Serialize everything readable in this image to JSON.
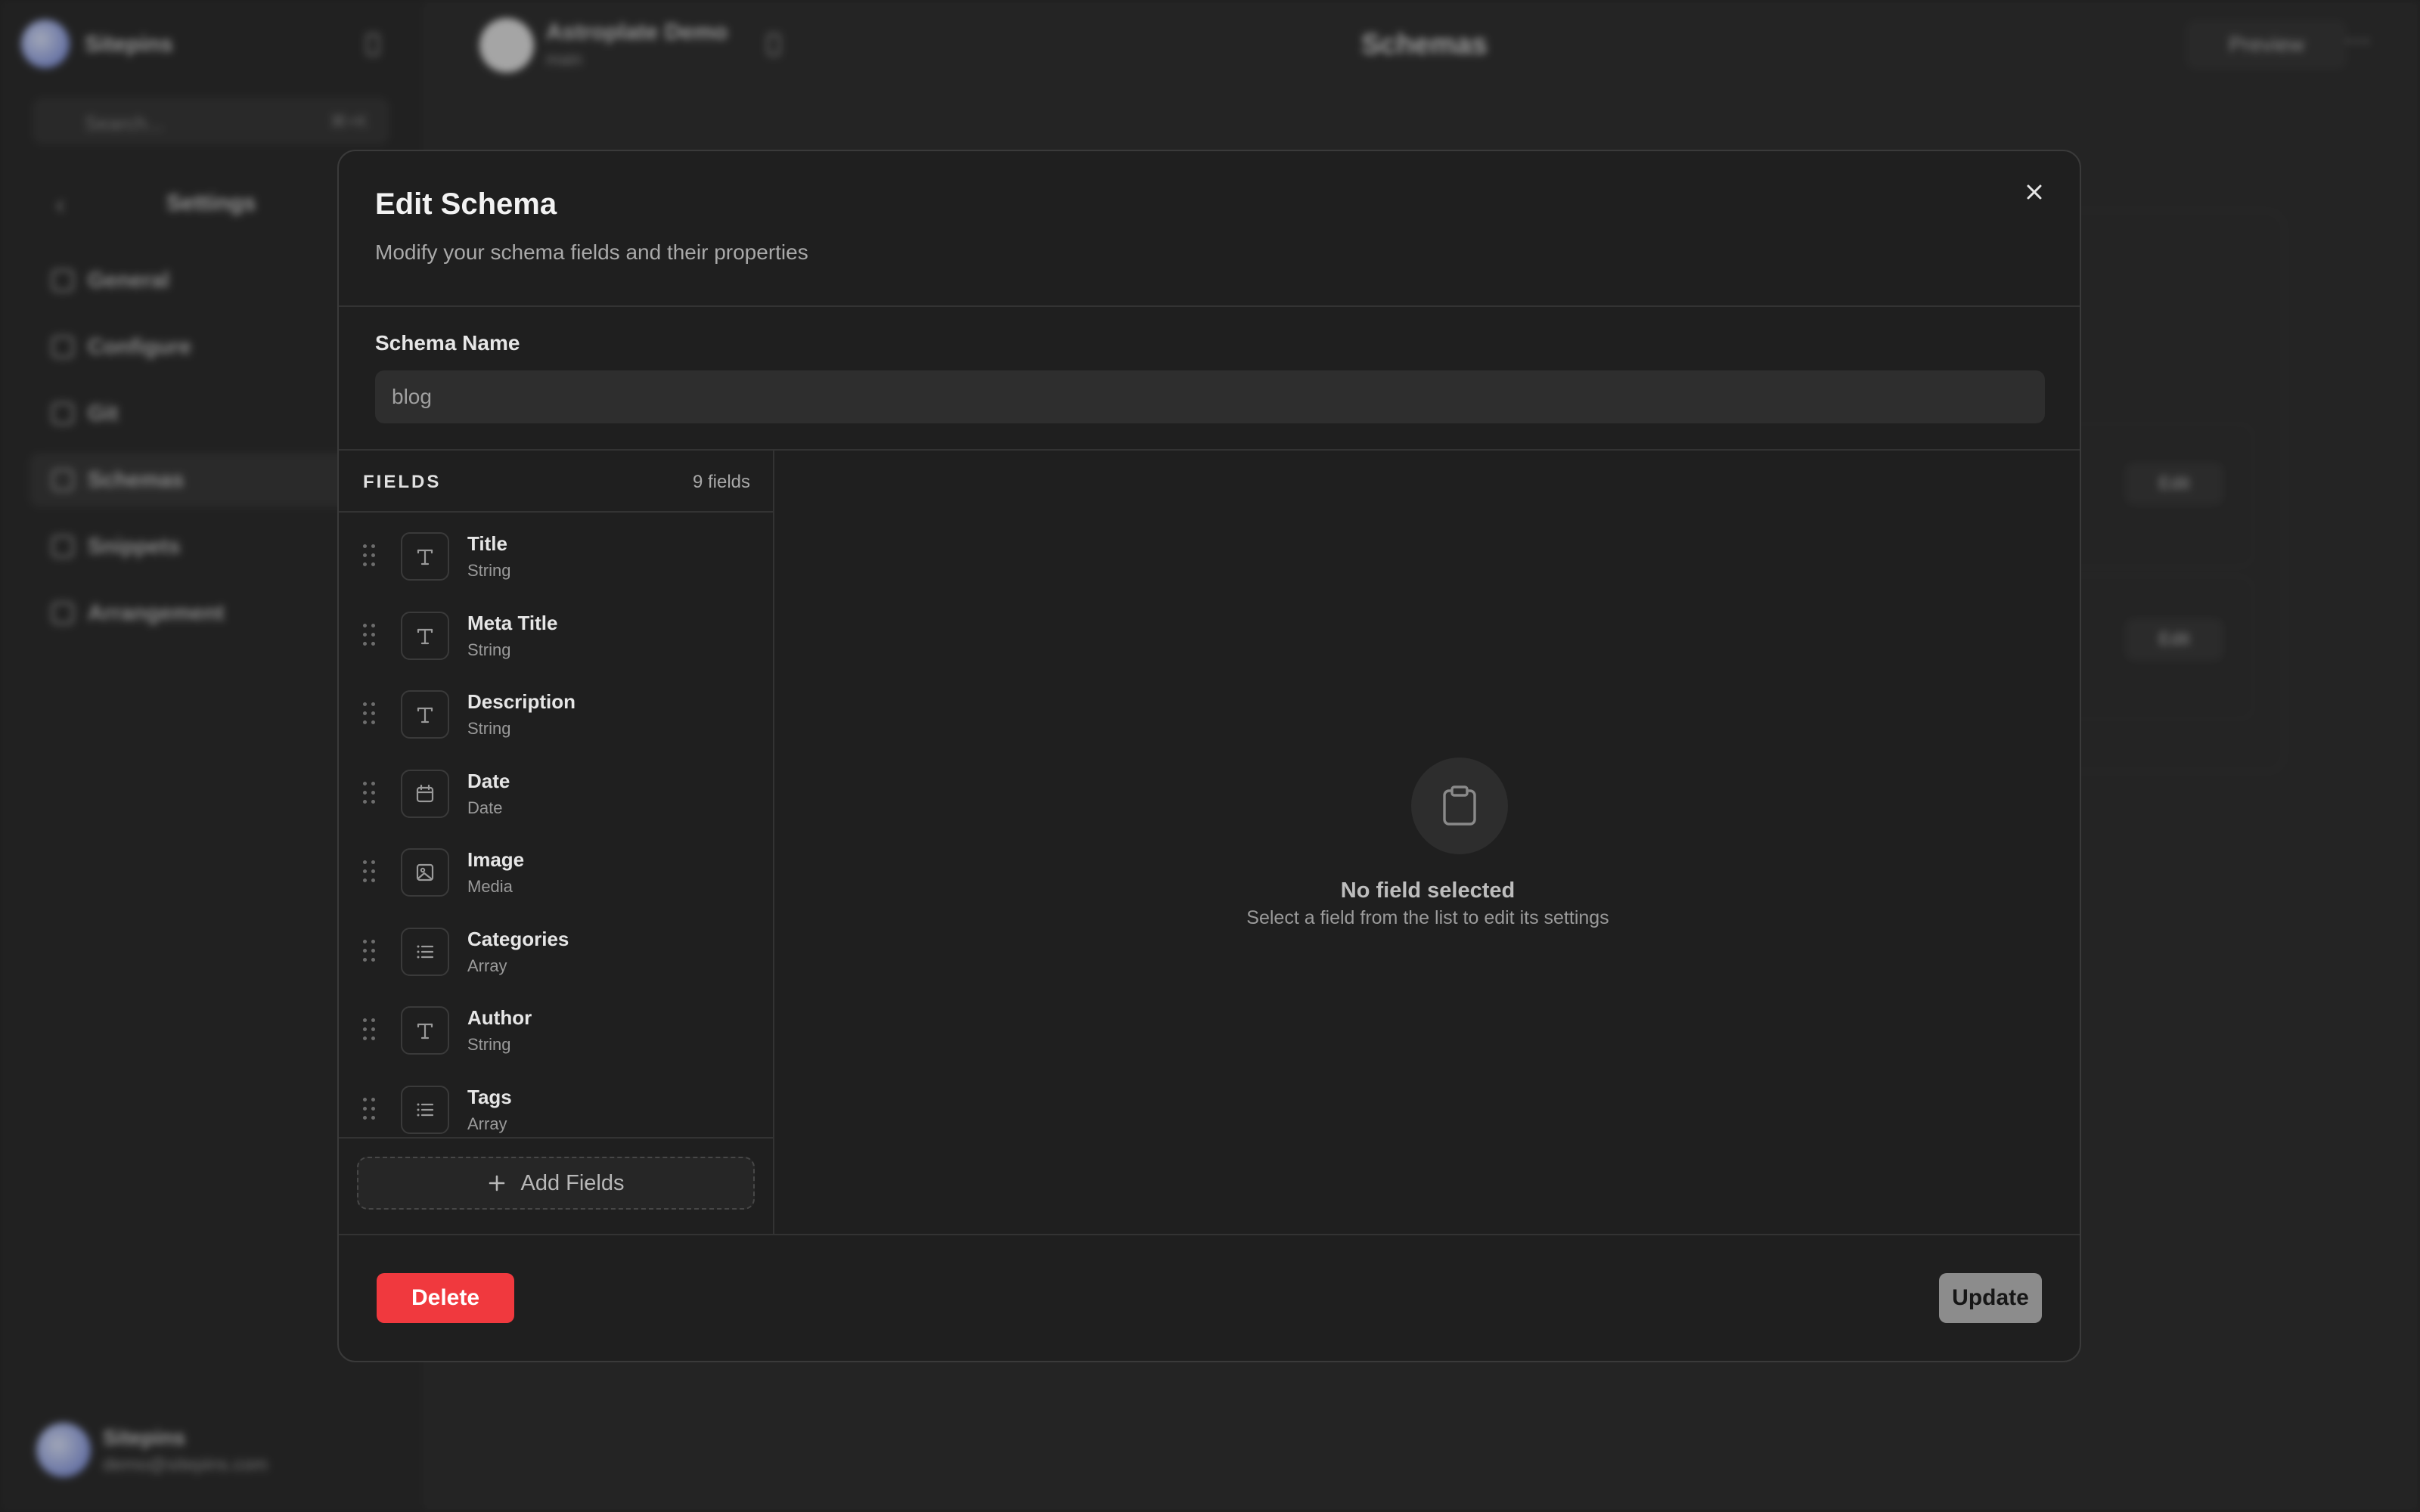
{
  "background": {
    "brand": "Sitepins",
    "search_placeholder": "Search...",
    "search_shortcut": "⌘+K",
    "settings_title": "Settings",
    "nav": [
      "General",
      "Configure",
      "Git",
      "Schemas",
      "Snippets",
      "Arrangement"
    ],
    "project_name": "Astroplate Demo",
    "project_sub": "main",
    "page_title": "Schemas",
    "preview_label": "Preview",
    "row_edit_label": "Edit",
    "user_name": "Sitepins",
    "user_email": "demo@sitepins.com"
  },
  "modal": {
    "title": "Edit Schema",
    "description": "Modify your schema fields and their properties",
    "schema_name_label": "Schema Name",
    "schema_name_value": "blog",
    "fields_header": "FIELDS",
    "fields_count": "9 fields",
    "fields": [
      {
        "name": "Title",
        "type": "String",
        "icon": "text-icon"
      },
      {
        "name": "Meta Title",
        "type": "String",
        "icon": "text-icon"
      },
      {
        "name": "Description",
        "type": "String",
        "icon": "text-icon"
      },
      {
        "name": "Date",
        "type": "Date",
        "icon": "calendar-icon"
      },
      {
        "name": "Image",
        "type": "Media",
        "icon": "image-icon"
      },
      {
        "name": "Categories",
        "type": "Array",
        "icon": "list-icon"
      },
      {
        "name": "Author",
        "type": "String",
        "icon": "text-icon"
      },
      {
        "name": "Tags",
        "type": "Array",
        "icon": "list-icon"
      }
    ],
    "add_fields_label": "Add Fields",
    "empty_title": "No field selected",
    "empty_subtitle": "Select a field from the list to edit its settings",
    "delete_label": "Delete",
    "update_label": "Update"
  },
  "colors": {
    "modal_bg": "#1f1f1f",
    "delete": "#f0393e",
    "update": "#8c8c8c"
  }
}
